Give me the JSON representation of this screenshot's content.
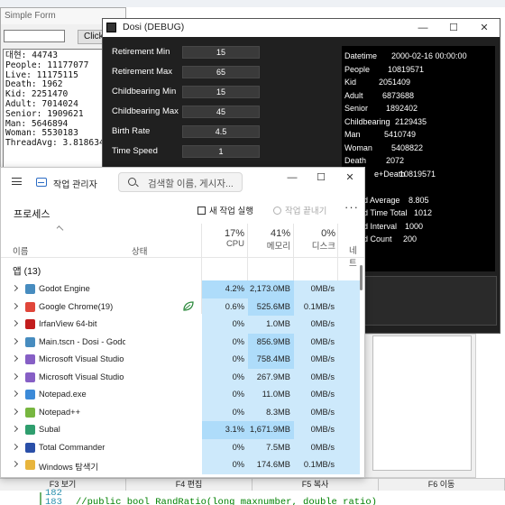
{
  "background": {
    "tc_keys": [
      "F3 보기",
      "F4 편집",
      "F5 복사",
      "F6 이동"
    ],
    "code_lines": [
      {
        "ln": "182",
        "text": ""
      },
      {
        "ln": "183",
        "text": "//public bool RandRatio(long maxnumber, double ratio)"
      }
    ]
  },
  "simple_form": {
    "title": "Simple Form",
    "button_label": "Click",
    "input_value": "",
    "lines": [
      "대현: 44743",
      "People: 11177077",
      "Live: 11175115",
      "Death: 1962",
      "Kid: 2251470",
      "Adult: 7014024",
      "Senior: 1909621",
      "Man: 5646894",
      "Woman: 5530183",
      "ThreadAvg: 3.818634"
    ]
  },
  "dosi": {
    "title": "Dosi (DEBUG)",
    "params": [
      {
        "label": "Retirement Min",
        "value": "15"
      },
      {
        "label": "Retirement Max",
        "value": "65"
      },
      {
        "label": "Childbearing Min",
        "value": "15"
      },
      {
        "label": "Childbearing Max",
        "value": "45"
      },
      {
        "label": "Birth Rate",
        "value": "4.5"
      },
      {
        "label": "Time Speed",
        "value": "1"
      }
    ],
    "stats": [
      {
        "label": "Datetime",
        "value": "2000-02-16 00:00:00"
      },
      {
        "label": "People",
        "value": "10819571"
      },
      {
        "label": "Kid",
        "value": "2051409"
      },
      {
        "label": "Adult",
        "value": "6873688"
      },
      {
        "label": "Senior",
        "value": "1892402"
      },
      {
        "label": "Childbearing",
        "value": "2129435"
      },
      {
        "label": "Man",
        "value": "5410749"
      },
      {
        "label": "Woman",
        "value": "5408822"
      },
      {
        "label": "Death",
        "value": "2072"
      },
      {
        "label": "e+Death",
        "value": "10819571"
      },
      {
        "label": "",
        "value": ""
      },
      {
        "label": "d Average",
        "value": "8.805"
      },
      {
        "label": "d Time Total",
        "value": "1012"
      },
      {
        "label": "d Interval",
        "value": "1000"
      },
      {
        "label": "d Count",
        "value": "200"
      }
    ],
    "window_controls": {
      "minimize": "—",
      "maximize": "☐",
      "close": "✕"
    }
  },
  "task_manager": {
    "title": "작업 관리자",
    "search_placeholder": "검색할 이름, 게시자...",
    "heading": "프로세스",
    "new_task": "새 작업 실행",
    "end_task": "작업 끝내기",
    "more": "···",
    "window_controls": {
      "minimize": "—",
      "maximize": "☐",
      "close": "✕"
    },
    "columns": {
      "name": "이름",
      "status": "상태",
      "cpu_pct": "17%",
      "cpu": "CPU",
      "mem_pct": "41%",
      "mem": "메모리",
      "disk_pct": "0%",
      "disk": "디스크",
      "net": "네트"
    },
    "group": "앱 (13)",
    "rows": [
      {
        "name": "Godot Engine",
        "icon": "godot-icon",
        "color": "#478cbf",
        "cpu": "4.2%",
        "mem": "2,173.0MB",
        "disk": "0MB/s",
        "net": "",
        "cpu_heat": 2,
        "mem_heat": 2,
        "eco": false
      },
      {
        "name": "Google Chrome(19)",
        "icon": "chrome-icon",
        "color": "#e0463a",
        "cpu": "0.6%",
        "mem": "525.6MB",
        "disk": "0.1MB/s",
        "net": "",
        "cpu_heat": 1,
        "mem_heat": 2,
        "eco": true
      },
      {
        "name": "IrfanView 64-bit",
        "icon": "irfanview-icon",
        "color": "#c21d1d",
        "cpu": "0%",
        "mem": "1.0MB",
        "disk": "0MB/s",
        "net": "",
        "cpu_heat": 1,
        "mem_heat": 1,
        "eco": false
      },
      {
        "name": "Main.tscn - Dosi - Godot Engine",
        "icon": "godot-icon",
        "color": "#478cbf",
        "cpu": "0%",
        "mem": "856.9MB",
        "disk": "0MB/s",
        "net": "",
        "cpu_heat": 1,
        "mem_heat": 2,
        "eco": false
      },
      {
        "name": "Microsoft Visual Studio",
        "icon": "visual-studio-icon",
        "color": "#865fc5",
        "cpu": "0%",
        "mem": "758.4MB",
        "disk": "0MB/s",
        "net": "",
        "cpu_heat": 1,
        "mem_heat": 2,
        "eco": false
      },
      {
        "name": "Microsoft Visual Studio",
        "icon": "visual-studio-icon",
        "color": "#865fc5",
        "cpu": "0%",
        "mem": "267.9MB",
        "disk": "0MB/s",
        "net": "",
        "cpu_heat": 1,
        "mem_heat": 1,
        "eco": false
      },
      {
        "name": "Notepad.exe",
        "icon": "notepad-icon",
        "color": "#3c8ad8",
        "cpu": "0%",
        "mem": "11.0MB",
        "disk": "0MB/s",
        "net": "",
        "cpu_heat": 1,
        "mem_heat": 1,
        "eco": false
      },
      {
        "name": "Notepad++",
        "icon": "notepadpp-icon",
        "color": "#77b640",
        "cpu": "0%",
        "mem": "8.3MB",
        "disk": "0MB/s",
        "net": "",
        "cpu_heat": 1,
        "mem_heat": 1,
        "eco": false
      },
      {
        "name": "Subal",
        "icon": "subal-icon",
        "color": "#2f9e6e",
        "cpu": "3.1%",
        "mem": "1,671.9MB",
        "disk": "0MB/s",
        "net": "",
        "cpu_heat": 2,
        "mem_heat": 2,
        "eco": false
      },
      {
        "name": "Total Commander",
        "icon": "total-commander-icon",
        "color": "#2a4fa8",
        "cpu": "0%",
        "mem": "7.5MB",
        "disk": "0MB/s",
        "net": "",
        "cpu_heat": 1,
        "mem_heat": 1,
        "eco": false
      },
      {
        "name": "Windows 탐색기",
        "icon": "explorer-icon",
        "color": "#e8b53d",
        "cpu": "0%",
        "mem": "174.6MB",
        "disk": "0.1MB/s",
        "net": "",
        "cpu_heat": 1,
        "mem_heat": 1,
        "eco": false
      }
    ]
  }
}
